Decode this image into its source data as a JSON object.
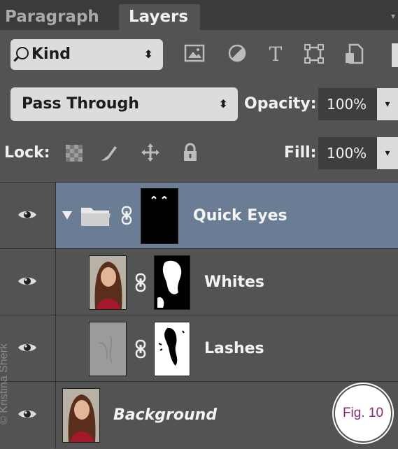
{
  "tabs": [
    {
      "label": "Paragraph",
      "active": false
    },
    {
      "label": "Layers",
      "active": true
    }
  ],
  "panel_menu_icon": "menu-chevron-icon",
  "filter": {
    "kind_label": "Kind",
    "filter_icons": [
      "image-filter-icon",
      "adjustment-filter-icon",
      "type-filter-icon",
      "shape-filter-icon",
      "smart-object-filter-icon"
    ]
  },
  "blend": {
    "mode": "Pass Through",
    "opacity_label": "Opacity:",
    "opacity_value": "100%"
  },
  "lock": {
    "label": "Lock:",
    "icons": [
      "lock-transparent-pixels-icon",
      "lock-image-pixels-icon",
      "lock-position-icon",
      "lock-all-icon"
    ],
    "fill_label": "Fill:",
    "fill_value": "100%"
  },
  "layers": [
    {
      "name": "Quick Eyes",
      "type": "group",
      "visible": true,
      "selected": true
    },
    {
      "name": "Whites",
      "type": "masked-layer",
      "visible": true,
      "selected": false
    },
    {
      "name": "Lashes",
      "type": "masked-layer",
      "visible": true,
      "selected": false
    },
    {
      "name": "Background",
      "type": "background",
      "visible": true,
      "selected": false
    }
  ],
  "figure_label": "Fig. 10",
  "watermark": "© Kristina Sherk",
  "colors": {
    "selected_row": "#6b7d94",
    "panel_bg": "#535353",
    "figure_text": "#8b2a6e"
  }
}
